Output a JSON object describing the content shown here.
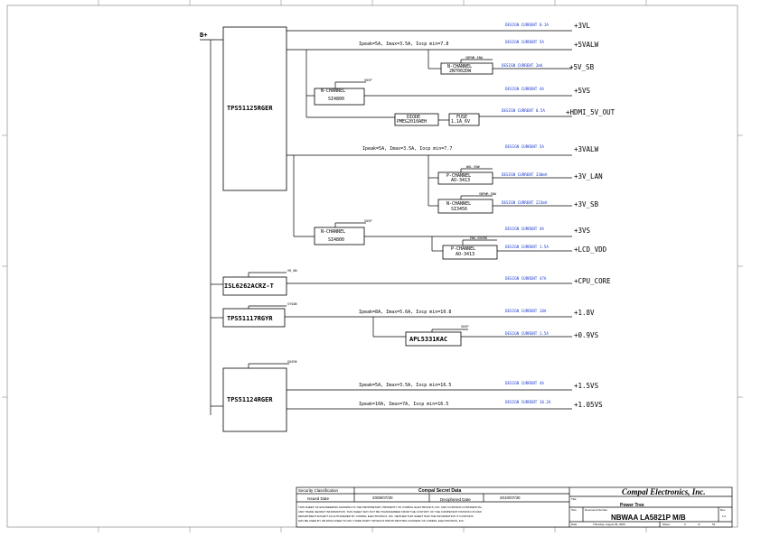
{
  "input_net": "B+",
  "chips": {
    "tps1": "TPS51125RGER",
    "isl": "ISL6262ACRZ-T",
    "tps2": "TPS51117RGYR",
    "tps3": "TPS51124RGER",
    "apl": "APL5331KAC"
  },
  "parts": {
    "nch_top_1": "N-CHANNEL",
    "nch_top_2": "2N7002DW",
    "nch_a_1": "N-CHANNEL",
    "nch_a_2": "SI4800",
    "diode_1": "DIODE",
    "diode_2": "PMEG2010AEH",
    "fuse_1": "FUSE",
    "fuse_2": "1.1A_6V",
    "pch_lan_1": "P-CHANNEL",
    "pch_lan_2": "AO-3413",
    "nch_sb_1": "N-CHANNEL",
    "nch_sb_2": "SI3456",
    "nch_b_1": "N-CHANNEL",
    "nch_b_2": "SI4800",
    "pch_lcd_1": "P-CHANNEL",
    "pch_lcd_2": "AO-3413"
  },
  "enables": {
    "sb_top": "SBPWR_EN#",
    "susp_a": "SUSP",
    "lan": "WOL_EN#",
    "sb2": "SBPWR_EN#",
    "susp_b": "SUSP",
    "lcd": "ENA_ENVDD",
    "vr": "VR_ON",
    "sysonb": "SYSON",
    "susp_apl": "SUSP",
    "susp_tps3": "SUSP#"
  },
  "specs": {
    "s1": "Ipeak=5A, Imax=3.5A, Iocp min=7.8",
    "s2": "Ipeak=5A, Imax=3.5A, Iocp min=7.7",
    "s3": "Ipeak=8A, Imax=5.6A, Iocp min=10.8",
    "s4": "Ipeak=5A, Imax=3.5A, Iocp min=16.5",
    "s5": "Ipeak=10A, Imax=7A, Iocp min=16.5"
  },
  "rails": [
    {
      "name": "+3VL",
      "current": "DESIGN CURRENT 0.1A"
    },
    {
      "name": "+5VALW",
      "current": "DESIGN CURRENT 5A"
    },
    {
      "name": "+5V_SB",
      "current": "DESIGN CURRENT 2mA"
    },
    {
      "name": "+5VS",
      "current": "DESIGN CURRENT 4A"
    },
    {
      "name": "+HDMI_5V_OUT",
      "current": "DESIGN CURRENT 0.5A"
    },
    {
      "name": "+3VALW",
      "current": "DESIGN CURRENT 5A"
    },
    {
      "name": "+3V_LAN",
      "current": "DESIGN CURRENT 330mA"
    },
    {
      "name": "+3V_SB",
      "current": "DESIGN CURRENT 223mA"
    },
    {
      "name": "+3VS",
      "current": "DESIGN CURRENT 4A"
    },
    {
      "name": "+LCD_VDD",
      "current": "DESIGN CURRENT 1.5A"
    },
    {
      "name": "+CPU_CORE",
      "current": "DESIGN CURRENT 47A"
    },
    {
      "name": "+1.8V",
      "current": "DESIGN CURRENT 10A"
    },
    {
      "name": "+0.9VS",
      "current": "DESIGN CURRENT 1.5A"
    },
    {
      "name": "+1.5VS",
      "current": "DESIGN CURRENT 4A"
    },
    {
      "name": "+1.05VS",
      "current": "DESIGN CURRENT 10.2A"
    }
  ],
  "title_block": {
    "sec_class": "Security Classification",
    "secret": "Compal Secret Data",
    "issued_label": "Issued Date",
    "issued": "2008/07/30",
    "decipher_label": "Deciphered Date",
    "decipher": "2010/07/30",
    "company": "Compal Electronics, Inc.",
    "title_label": "Title",
    "title": "Power Tree",
    "size_label": "Size",
    "docnum_label": "Document Number",
    "rev_label": "Rev",
    "rev": "1.0",
    "docnum": "NBWAA LA5821P M/B",
    "date_label": "Date",
    "date": "Thursday, August 06, 2009",
    "sheet_label": "Sheet",
    "sheet": "3",
    "of_label": "of",
    "total": "51",
    "notice_1": "THIS SHEET OF ENGINEERING DRAWING IS THE PROPRIETARY PROPERTY OF COMPAL ELECTRONICS, INC. AND CONTAINS CONFIDENTIAL",
    "notice_2": "AND TRADE SECRET INFORMATION. THIS SHEET MAY NOT BE TRANSFERRED FROM THE CUSTODY OF THE COMPETENT DIVISION OF R&D",
    "notice_3": "DEPARTMENT EXCEPT AS AUTHORIZED BY COMPAL ELECTRONICS, INC. NEITHER THIS SHEET NOR THE INFORMATION IT CONTAINS",
    "notice_4": "MAY BE USED BY OR DISCLOSED TO ANY THIRD PARTY WITHOUT PRIOR WRITTEN CONSENT OF COMPAL ELECTRONICS, INC."
  }
}
